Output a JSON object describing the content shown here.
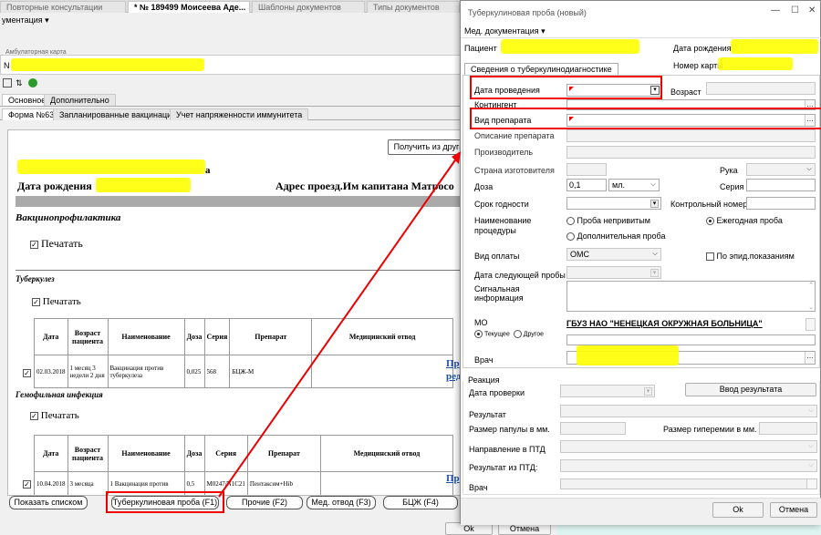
{
  "tabs": [
    {
      "label": "Повторные консультации"
    },
    {
      "label": "* № 189499 Моисеева Аде..."
    },
    {
      "label": "Шаблоны документов"
    },
    {
      "label": "Типы документов"
    }
  ],
  "tab_close": "✕",
  "menu_label": "ументация ▾",
  "ambulatory_tab": "Амбулаторная карта",
  "number_prefix": "N",
  "subtabs": [
    "Основное",
    "Дополнительно"
  ],
  "form_tabs": [
    "Форма №63",
    "Запланированные вакцинации",
    "Учет напряженности иммунитета"
  ],
  "doc": {
    "get_button": "Получить из други",
    "birth_label": "Дата рождения",
    "address": "Адрес проезд.Им капитана Матросо",
    "vacc_title": "Вакцинопрофилактика",
    "print_label": "Печатать",
    "tb_section": "Туберкулез",
    "hemo_section": "Гемофильная инфекция",
    "table_headers": [
      "Дата",
      "Возраст пациента",
      "Наименование",
      "Доза",
      "Серия",
      "Препарат",
      "Медицинский отвод"
    ],
    "row1": [
      "02.03.2018",
      "1 месяц 3 недели 2 дня",
      "Вакцинация против туберкулеза",
      "0,025",
      "568",
      "БЦЖ-М",
      ""
    ],
    "row2": [
      "10.04.2018",
      "3 месяца",
      "1 Вакцинация против",
      "0,5",
      "М0247/N1С21",
      "Пентаксим+Hib",
      ""
    ],
    "link1": "Пр",
    "link1b": "ред",
    "link2": "Пр",
    "name_frag": "а"
  },
  "bottom_buttons": [
    "Показать списком",
    "Туберкулиновая проба (F1)",
    "Прочие (F2)",
    "Мед. отвод (F3)",
    "БЦЖ (F4)"
  ],
  "main_ok": "Ok",
  "main_cancel": "Отмена",
  "dialog": {
    "title": "Туберкулиновая проба (новый)",
    "minimize": "—",
    "maximize": "☐",
    "close": "✕",
    "menu": "Мед. документация ▾",
    "patient_label": "Пациент",
    "birth_label": "Дата рождения",
    "card_label": "Номер карты",
    "tab": "Сведения о туберкулинодиагностике",
    "fields": {
      "date": "Дата проведения",
      "age": "Возраст",
      "contingent": "Контингент",
      "prep_type": "Вид препарата",
      "prep_desc": "Описание препарата",
      "producer": "Производитель",
      "country": "Страна изготовителя",
      "hand": "Рука",
      "dose": "Доза",
      "dose_value": "0,1",
      "dose_unit": "мл.",
      "series": "Серия",
      "expiry": "Срок годности",
      "control_number": "Контрольный номер",
      "procedure": "Наименование процедуры",
      "proc_opt1": "Проба непривитым",
      "proc_opt2": "Ежегодная проба",
      "proc_opt3": "Дополнительная проба",
      "payment": "Вид оплаты",
      "payment_value": "ОМС",
      "epid": "По эпид.показаниям",
      "next_date": "Дата следующей пробы",
      "signal": "Сигнальная информация",
      "mo": "МО",
      "mo_current": "Текущее",
      "mo_other": "Другое",
      "mo_value": "ГБУЗ НАО \"НЕНЕЦКАЯ ОКРУЖНАЯ БОЛЬНИЦА\"",
      "doctor": "Врач"
    },
    "reaction": {
      "group": "Реакция",
      "check_date": "Дата проверки",
      "enter_result": "Ввод результата",
      "result": "Результат",
      "papule": "Размер папулы в мм.",
      "hyperemia": "Размер гиперемии в мм.",
      "ptd_dir": "Направление в ПТД",
      "ptd_result": "Результат из ПТД:",
      "doctor": "Врач"
    },
    "ok": "Ok",
    "cancel": "Отмена"
  }
}
